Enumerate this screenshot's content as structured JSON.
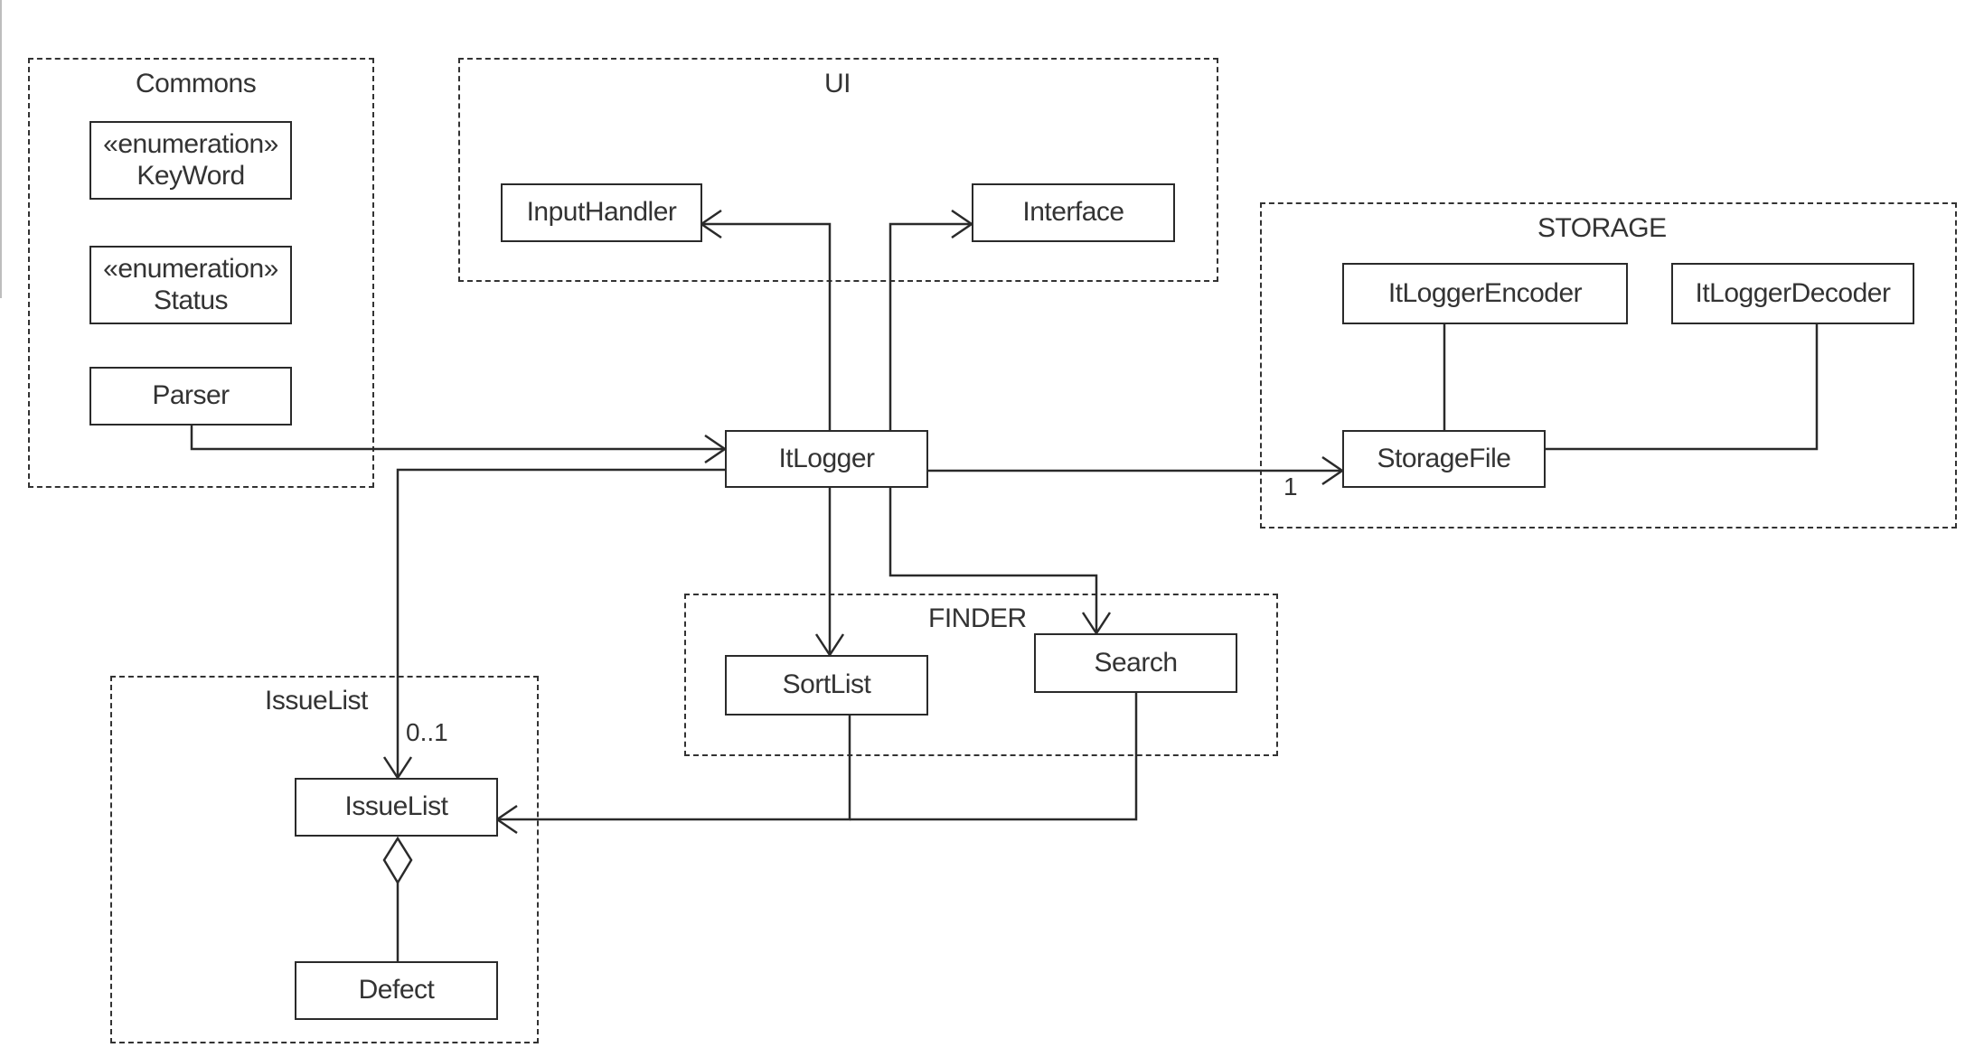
{
  "diagram": {
    "type": "UML class/package diagram",
    "packages": [
      {
        "id": "commons",
        "title": "Commons"
      },
      {
        "id": "ui",
        "title": "UI"
      },
      {
        "id": "storage",
        "title": "STORAGE"
      },
      {
        "id": "finder",
        "title": "FINDER"
      },
      {
        "id": "issuelist",
        "title": "IssueList"
      }
    ],
    "classes": {
      "keyword": {
        "stereotype": "«enumeration»",
        "name": "KeyWord",
        "package": "commons"
      },
      "status": {
        "stereotype": "«enumeration»",
        "name": "Status",
        "package": "commons"
      },
      "parser": {
        "name": "Parser",
        "package": "commons"
      },
      "inputhandler": {
        "name": "InputHandler",
        "package": "ui"
      },
      "interface": {
        "name": "Interface",
        "package": "ui"
      },
      "encoder": {
        "name": "ItLoggerEncoder",
        "package": "storage"
      },
      "decoder": {
        "name": "ItLoggerDecoder",
        "package": "storage"
      },
      "storagefile": {
        "name": "StorageFile",
        "package": "storage"
      },
      "itlogger": {
        "name": "ItLogger",
        "package": null
      },
      "sortlist": {
        "name": "SortList",
        "package": "finder"
      },
      "search": {
        "name": "Search",
        "package": "finder"
      },
      "issuelist": {
        "name": "IssueList",
        "package": "issuelist"
      },
      "defect": {
        "name": "Defect",
        "package": "issuelist"
      }
    },
    "relations": [
      {
        "from": "Parser",
        "to": "ItLogger",
        "kind": "directed-association"
      },
      {
        "from": "ItLogger",
        "to": "InputHandler",
        "kind": "directed-association"
      },
      {
        "from": "ItLogger",
        "to": "Interface",
        "kind": "directed-association"
      },
      {
        "from": "ItLogger",
        "to": "StorageFile",
        "kind": "directed-association",
        "multiplicity": "1"
      },
      {
        "from": "ItLogger",
        "to": "IssueList",
        "kind": "directed-association",
        "multiplicity": "0..1"
      },
      {
        "from": "ItLogger",
        "to": "SortList",
        "kind": "directed-association"
      },
      {
        "from": "ItLogger",
        "to": "Search",
        "kind": "directed-association"
      },
      {
        "from": "SortList",
        "to": "IssueList",
        "kind": "directed-association"
      },
      {
        "from": "Search",
        "to": "IssueList",
        "kind": "directed-association"
      },
      {
        "from": "ItLoggerEncoder",
        "to": "StorageFile",
        "kind": "association"
      },
      {
        "from": "ItLoggerDecoder",
        "to": "StorageFile",
        "kind": "association"
      },
      {
        "from": "IssueList",
        "to": "Defect",
        "kind": "aggregation"
      }
    ],
    "multiplicities": {
      "storagefile": "1",
      "issuelist": "0..1"
    }
  }
}
